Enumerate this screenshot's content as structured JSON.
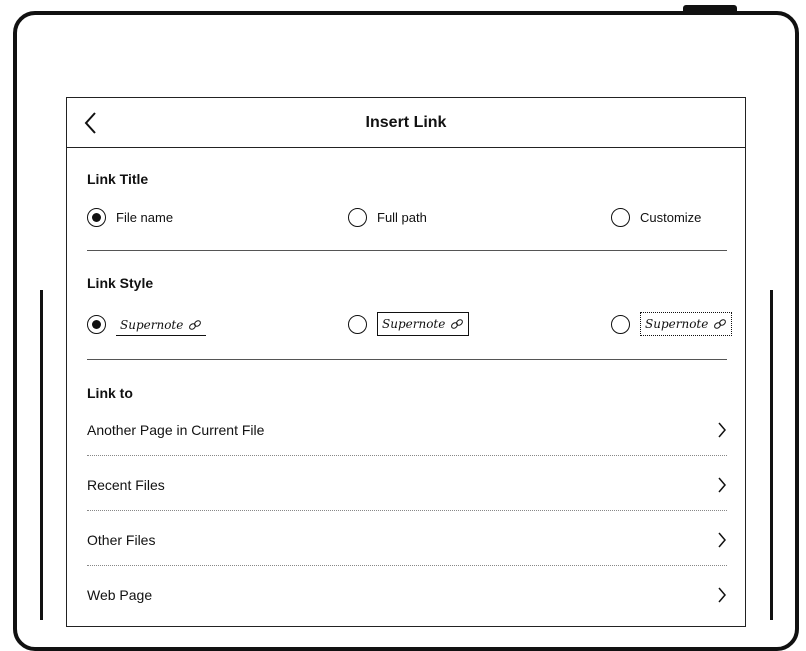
{
  "dialog": {
    "title": "Insert Link",
    "back_icon": "chevron-left-icon"
  },
  "link_title": {
    "label": "Link Title",
    "selected": "File name",
    "options": [
      "File name",
      "Full path",
      "Customize"
    ]
  },
  "link_style": {
    "label": "Link Style",
    "selected_index": 0,
    "samples": [
      {
        "text": "Supernote",
        "style": "underline",
        "icon": "link-icon"
      },
      {
        "text": "Supernote",
        "style": "solid-box",
        "icon": "link-icon"
      },
      {
        "text": "Supernote",
        "style": "dotted-box",
        "icon": "link-icon"
      }
    ]
  },
  "link_to": {
    "label": "Link to",
    "items": [
      {
        "label": "Another Page in Current File",
        "icon": "chevron-right-icon"
      },
      {
        "label": "Recent Files",
        "icon": "chevron-right-icon"
      },
      {
        "label": "Other Files",
        "icon": "chevron-right-icon"
      },
      {
        "label": "Web Page",
        "icon": "chevron-right-icon"
      }
    ]
  }
}
